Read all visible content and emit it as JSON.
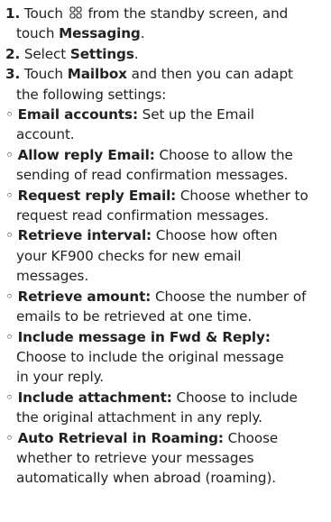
{
  "steps": [
    {
      "num": "1.",
      "text_a": "Touch",
      "icon": "menu-grid-icon",
      "text_b": "from the standby screen, and",
      "text_c": "touch",
      "bold": "Messaging",
      "end": "."
    },
    {
      "num": "2.",
      "text": "Select",
      "bold": "Settings",
      "end": "."
    },
    {
      "num": "3.",
      "text_a": "Touch",
      "bold": "Mailbox",
      "text_b": "and then you can adapt",
      "text_c": "the following settings:"
    }
  ],
  "settings": [
    {
      "label": "Email accounts:",
      "lines": [
        "Set up the Email",
        "account."
      ]
    },
    {
      "label": "Allow reply Email:",
      "lines": [
        "Choose to allow the",
        "sending of read confirmation messages."
      ]
    },
    {
      "label": "Request reply Email:",
      "lines": [
        "Choose whether to",
        "request read confirmation messages."
      ]
    },
    {
      "label": "Retrieve interval:",
      "lines": [
        "Choose how often",
        "your KF900 checks for new email",
        "messages."
      ]
    },
    {
      "label": "Retrieve amount:",
      "lines": [
        "Choose the number of",
        "emails to be retrieved at one time."
      ]
    },
    {
      "label": "Include message in Fwd & Reply:",
      "lines": [
        "",
        "Choose to include the original message",
        "in your reply."
      ]
    },
    {
      "label": "Include attachment:",
      "lines": [
        "Choose to include",
        "the original attachment in any reply."
      ]
    },
    {
      "label": "Auto Retrieval in Roaming:",
      "lines": [
        "Choose",
        "whether to retrieve your messages",
        "automatically when abroad (roaming)."
      ]
    }
  ],
  "bullet": "◦"
}
